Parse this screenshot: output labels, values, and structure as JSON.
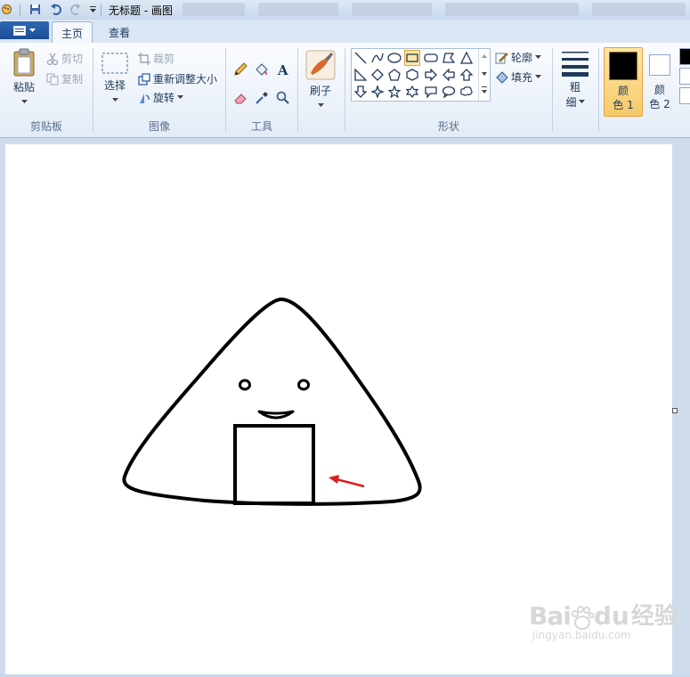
{
  "window": {
    "title": "无标题 - 画图"
  },
  "tabs": [
    {
      "label": "主页"
    },
    {
      "label": "查看"
    }
  ],
  "clipboard": {
    "paste": "粘贴",
    "cut": "剪切",
    "copy": "复制",
    "group_label": "剪贴板"
  },
  "image": {
    "select": "选择",
    "crop": "裁剪",
    "resize": "重新调整大小",
    "rotate": "旋转",
    "group_label": "图像"
  },
  "tools": {
    "group_label": "工具"
  },
  "brushes": {
    "label": "刷子"
  },
  "shapes": {
    "group_label": "形状",
    "outline": "轮廓",
    "fill": "填充"
  },
  "size": {
    "label_line1": "粗",
    "label_line2": "细"
  },
  "colors": {
    "color1_line1": "颜",
    "color1_line2": "色 1",
    "color2_line1": "颜",
    "color2_line2": "色 2",
    "color1": "#000000",
    "color2": "#ffffff"
  },
  "watermark": {
    "brand": "Bai",
    "brand2": "du",
    "brand3": "经验",
    "url": "jingyan.baidu.com"
  }
}
